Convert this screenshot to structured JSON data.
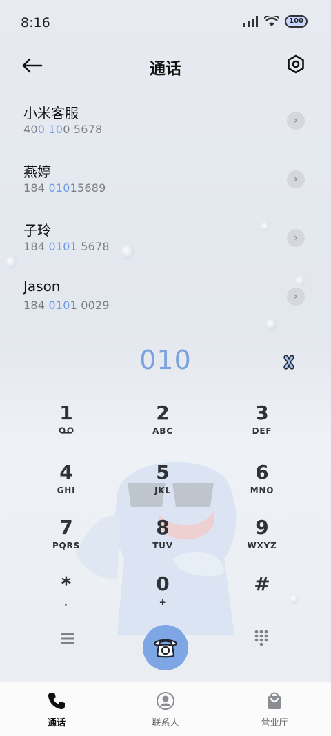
{
  "status_bar": {
    "time": "8:16",
    "battery": "100"
  },
  "header": {
    "title": "通话"
  },
  "contacts": [
    {
      "name": "小米客服",
      "number_parts": [
        "40",
        "0 10",
        "0 5678"
      ]
    },
    {
      "name": "燕婷",
      "number_parts": [
        "184 ",
        "010",
        "15689"
      ]
    },
    {
      "name": "子玲",
      "number_parts": [
        "184 ",
        "010",
        "1 5678"
      ]
    },
    {
      "name": "Jason",
      "number_parts": [
        "184 ",
        "010",
        "1 0029"
      ]
    }
  ],
  "dialer": {
    "input": "010"
  },
  "keys": [
    {
      "digit": "1",
      "letters": ""
    },
    {
      "digit": "2",
      "letters": "ABC"
    },
    {
      "digit": "3",
      "letters": "DEF"
    },
    {
      "digit": "4",
      "letters": "GHI"
    },
    {
      "digit": "5",
      "letters": "JKL"
    },
    {
      "digit": "6",
      "letters": "MNO"
    },
    {
      "digit": "7",
      "letters": "PQRS"
    },
    {
      "digit": "8",
      "letters": "TUV"
    },
    {
      "digit": "9",
      "letters": "WXYZ"
    },
    {
      "digit": "*",
      "letters": ","
    },
    {
      "digit": "0",
      "letters": "+"
    },
    {
      "digit": "#",
      "letters": ""
    }
  ],
  "bottom_nav": [
    {
      "label": "通话",
      "icon": "phone-icon",
      "active": true
    },
    {
      "label": "联系人",
      "icon": "person-icon",
      "active": false
    },
    {
      "label": "营业厅",
      "icon": "shopping-bag-icon",
      "active": false
    }
  ],
  "colors": {
    "accent": "#7fa6e4",
    "highlight": "#6e9ce8"
  }
}
